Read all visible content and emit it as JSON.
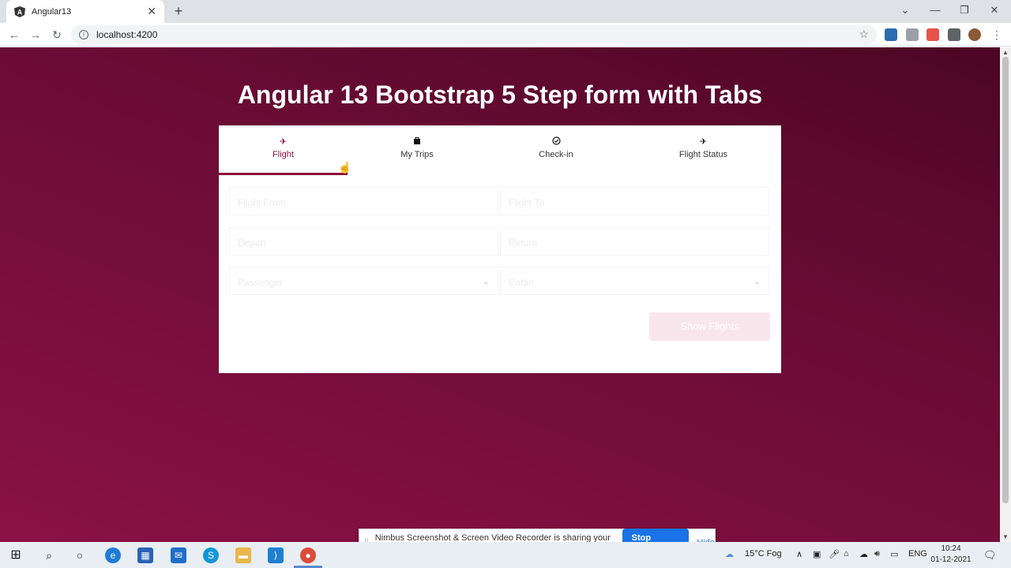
{
  "browser": {
    "tab_title": "Angular13",
    "tab_close": "✕",
    "new_tab": "+",
    "url": "localhost:4200",
    "win_min": "—",
    "win_max": "❐",
    "win_close": "✕",
    "win_dropdown": "⌄"
  },
  "page": {
    "heading": "Angular 13 Bootstrap 5 Step form with Tabs",
    "tabs": [
      {
        "label": "Flight",
        "icon": "✈"
      },
      {
        "label": "My Trips",
        "icon": "👜"
      },
      {
        "label": "Check-in",
        "icon": "✓"
      },
      {
        "label": "Flight Status",
        "icon": "✈"
      }
    ],
    "fields": {
      "flight_from": "Flight From",
      "flight_to": "Flight To",
      "depart": "Depart",
      "return": "Return",
      "passenger": "Passenger",
      "cabin": "Cabin"
    },
    "submit_label": "Show Flights"
  },
  "sharebar": {
    "message": "Nimbus Screenshot & Screen Video Recorder is sharing your screen.",
    "stop_label": "Stop sharing",
    "hide_label": "Hide"
  },
  "taskbar": {
    "weather": "15°C  Fog",
    "lang": "ENG",
    "time": "10:24",
    "date": "01-12-2021"
  },
  "colors": {
    "accent": "#8b0e3a",
    "page_gradient_start": "#4d0624",
    "page_gradient_end": "#8a1146"
  }
}
